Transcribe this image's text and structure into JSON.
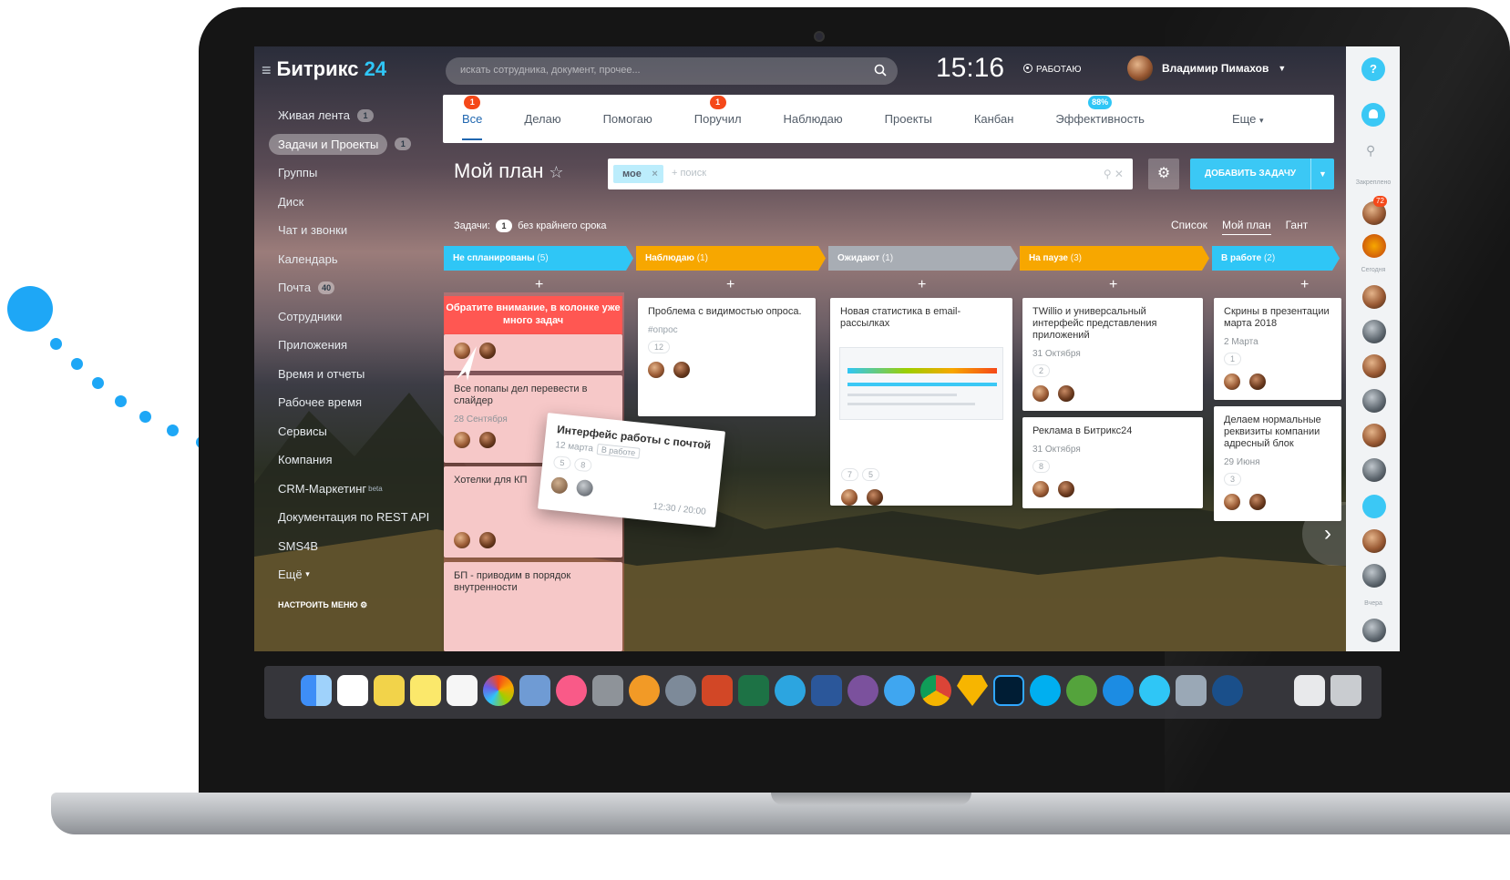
{
  "app": {
    "brand": "Битрикс",
    "brand_num": "24"
  },
  "header": {
    "search_placeholder": "искать сотрудника, документ, прочее...",
    "clock": "15:16",
    "work_status": "РАБОТАЮ",
    "user_name": "Владимир Пимахов"
  },
  "menu": {
    "items": [
      {
        "label": "Живая лента",
        "counter": "1"
      },
      {
        "label": "Задачи и Проекты",
        "counter": "1",
        "active": true
      },
      {
        "label": "Группы"
      },
      {
        "label": "Диск"
      },
      {
        "label": "Чат и звонки"
      },
      {
        "label": "Календарь"
      },
      {
        "label": "Почта",
        "counter": "40"
      },
      {
        "label": "Сотрудники"
      },
      {
        "label": "Приложения"
      },
      {
        "label": "Время и отчеты"
      },
      {
        "label": "Рабочее время"
      },
      {
        "label": "Сервисы"
      },
      {
        "label": "Компания"
      },
      {
        "label": "CRM-Маркетинг",
        "sup": "beta"
      },
      {
        "label": "Документация по REST API"
      },
      {
        "label": "SMS4B"
      },
      {
        "label": "Ещё"
      }
    ],
    "settings_label": "НАСТРОИТЬ МЕНЮ"
  },
  "tabs": [
    {
      "label": "Все",
      "badge": "1",
      "active": true
    },
    {
      "label": "Делаю"
    },
    {
      "label": "Помогаю"
    },
    {
      "label": "Поручил",
      "badge": "1"
    },
    {
      "label": "Наблюдаю"
    },
    {
      "label": "Проекты"
    },
    {
      "label": "Канбан"
    },
    {
      "label": "Эффективность",
      "badge": "88%"
    },
    {
      "label": "Еще"
    }
  ],
  "page": {
    "title": "Мой план",
    "filter_tag": "мое",
    "filter_placeholder": "+ поиск",
    "add_button": "ДОБАВИТЬ ЗАДАЧУ",
    "tasks_prefix": "Задачи:",
    "tasks_count": "1",
    "tasks_suffix": "без крайнего срока",
    "views": [
      "Список",
      "Мой план",
      "Гант"
    ]
  },
  "columns": [
    {
      "title": "Не спланированы",
      "count": "(5)",
      "color": "#2fc6f6"
    },
    {
      "title": "Наблюдаю",
      "count": "(1)",
      "color": "#f7a700"
    },
    {
      "title": "Ожидают",
      "count": "(1)",
      "color": "#a8adb4"
    },
    {
      "title": "На паузе",
      "count": "(3)",
      "color": "#f7a700"
    },
    {
      "title": "В работе",
      "count": "(2)",
      "color": "#2fc6f6"
    }
  ],
  "cards": {
    "alert": "Обратите внимание, в колонке уже много задач",
    "c1": {
      "title": "Все попапы дел перевести в слайдер",
      "date": "28 Сентября"
    },
    "c2": {
      "title": "Хотелки для КП"
    },
    "c3": {
      "title": "БП - приводим в порядок внутренности"
    },
    "c4": {
      "title": "Проблема с видимостью опроса.",
      "tag": "#опрос",
      "pill": "12"
    },
    "c5": {
      "title": "Новая статистика в email-рассылках",
      "pill1": "7",
      "pill2": "5"
    },
    "c6": {
      "title": "TWillio и универсальный интерфейс представления приложений",
      "date": "31 Октября",
      "pill": "2"
    },
    "c7": {
      "title": "Реклама в Битрикс24",
      "date": "31 Октября",
      "pill": "8"
    },
    "c8": {
      "title": "Скрины в презентации марта 2018",
      "date": "2 Марта",
      "pill": "1"
    },
    "c9": {
      "title": "Делаем нормальные реквизиты компании адресный блок",
      "date": "29 Июня",
      "pill": "3"
    },
    "drag": {
      "title": "Интерфейс работы с почтой",
      "date": "12 марта",
      "status": "В работе",
      "pill1": "5",
      "pill2": "8",
      "time": "12:30 / 20:00"
    }
  },
  "rail": {
    "help": "?",
    "label_pinned": "Закреплено",
    "label_today": "Сегодня",
    "label_yesterday": "Вчера",
    "badge": "72"
  }
}
